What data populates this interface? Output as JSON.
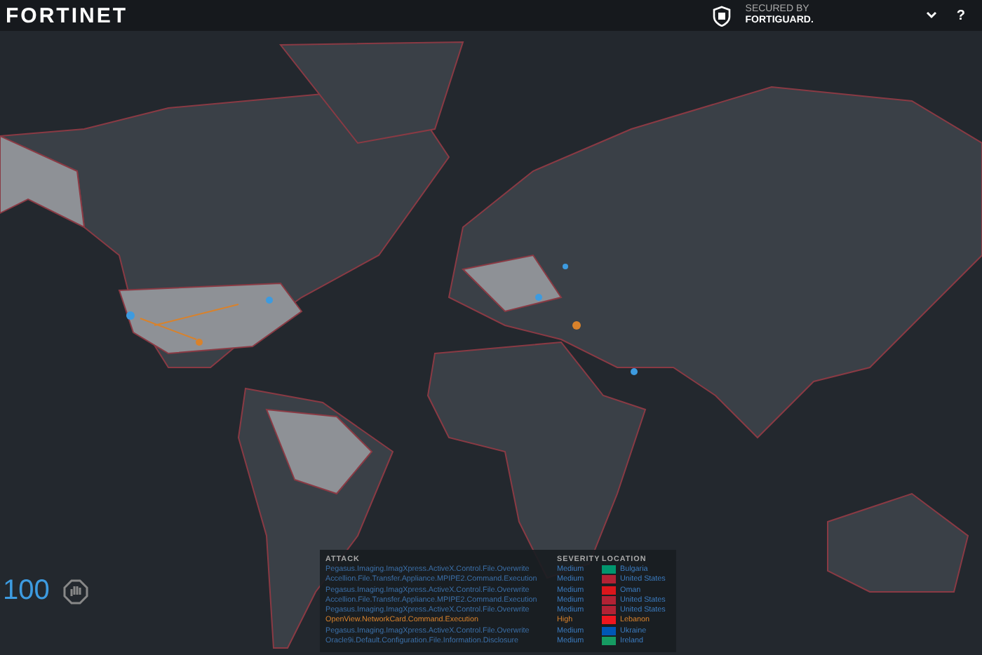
{
  "header": {
    "logo": "FORTINET",
    "badge_line_1": "SECURED BY",
    "badge_line_2": "FORTIGUARD.",
    "help": "?"
  },
  "counter": {
    "value": "100"
  },
  "attacks": {
    "columns": [
      "ATTACK",
      "SEVERITY",
      "LOCATION"
    ],
    "rows": [
      {
        "attack": "Pegasus.Imaging.ImagXpress.ActiveX.Control.File.Overwrite",
        "severity": "Medium",
        "kind": "medium",
        "location": "Bulgaria",
        "color": "#00966e"
      },
      {
        "attack": "Accellion.File.Transfer.Appliance.MPIPE2.Command.Execution",
        "severity": "Medium",
        "kind": "medium",
        "location": "United States",
        "color": "#b22234"
      },
      {
        "attack": "Pegasus.Imaging.ImagXpress.ActiveX.Control.File.Overwrite",
        "severity": "Medium",
        "kind": "medium",
        "location": "Oman",
        "color": "#db161b"
      },
      {
        "attack": "Accellion.File.Transfer.Appliance.MPIPE2.Command.Execution",
        "severity": "Medium",
        "kind": "medium",
        "location": "United States",
        "color": "#b22234"
      },
      {
        "attack": "Pegasus.Imaging.ImagXpress.ActiveX.Control.File.Overwrite",
        "severity": "Medium",
        "kind": "medium",
        "location": "United States",
        "color": "#b22234"
      },
      {
        "attack": "OpenView.NetworkCard.Command.Execution",
        "severity": "High",
        "kind": "high",
        "location": "Lebanon",
        "color": "#ee161f"
      },
      {
        "attack": "Pegasus.Imaging.ImagXpress.ActiveX.Control.File.Overwrite",
        "severity": "Medium",
        "kind": "medium",
        "location": "Ukraine",
        "color": "#0057b7"
      },
      {
        "attack": "Oracle9i.Default.Configuration.File.Information.Disclosure",
        "severity": "Medium",
        "kind": "medium",
        "location": "Ireland",
        "color": "#169b62"
      }
    ]
  }
}
